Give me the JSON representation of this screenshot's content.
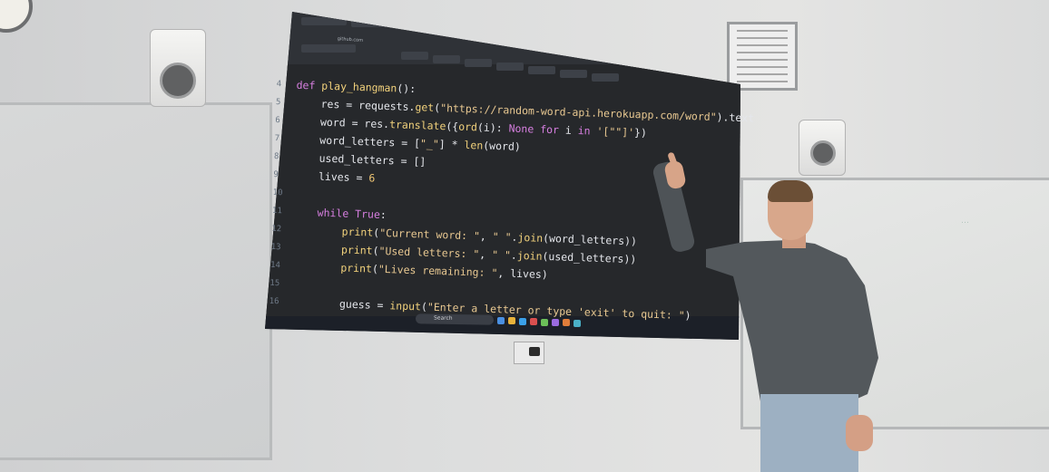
{
  "scene": {
    "code_lines": [
      {
        "num": "4",
        "text": "def play_hangman():"
      },
      {
        "num": "5",
        "text": "    res = requests.get(\"https://random-word-api.herokuapp.com/word\").text"
      },
      {
        "num": "6",
        "text": "    word = res.translate({ord(i): None for i in '[\"\"]'})"
      },
      {
        "num": "7",
        "text": "    word_letters = [\"_\"] * len(word)"
      },
      {
        "num": "8",
        "text": "    used_letters = []"
      },
      {
        "num": "9",
        "text": "    lives = 6"
      },
      {
        "num": "10",
        "text": ""
      },
      {
        "num": "11",
        "text": "    while True:"
      },
      {
        "num": "12",
        "text": "        print(\"Current word: \", \" \".join(word_letters))"
      },
      {
        "num": "13",
        "text": "        print(\"Used letters: \", \" \".join(used_letters))"
      },
      {
        "num": "14",
        "text": "        print(\"Lives remaining: \", lives)"
      },
      {
        "num": "15",
        "text": ""
      },
      {
        "num": "16",
        "text": "        guess = input(\"Enter a letter or type 'exit' to quit: \")"
      }
    ],
    "browser_url": "github.com",
    "taskbar_search": "Search",
    "colors": {
      "editor_bg": "#26282b",
      "keyword": "#d77fe0",
      "function": "#f2d27c",
      "string": "#e8c891",
      "text": "#e4e6eb",
      "hoodie": "#53585c",
      "jeans": "#9db0c2"
    }
  }
}
